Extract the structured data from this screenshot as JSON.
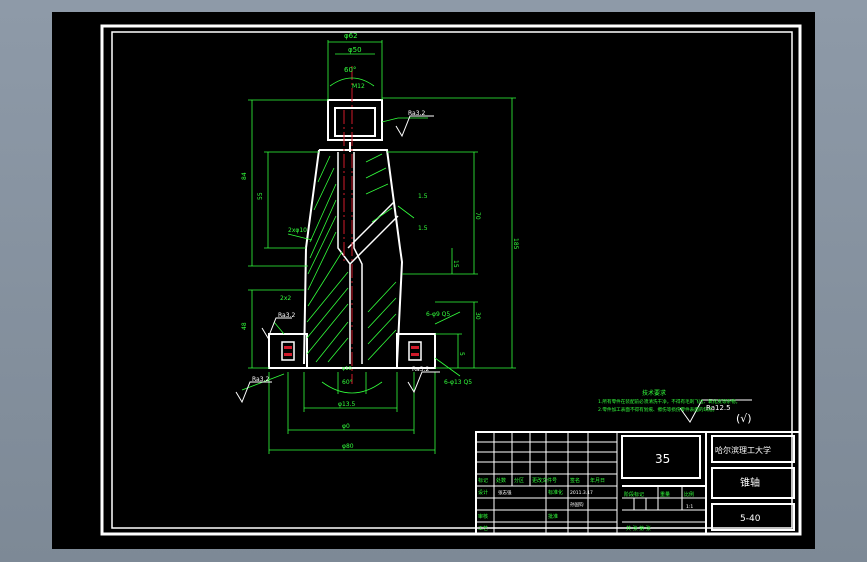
{
  "drawing": {
    "part_name": "锥轴",
    "university": "哈尔滨理工大学",
    "material": "35",
    "drawing_number": "5-40",
    "scale": "1:1"
  },
  "tech_requirements": {
    "title": "技术要求",
    "line1": "1.所有零件在装配前必须清洗干净，不得有毛刺飞边、氧化皮等杂物。",
    "line2": "2.零件加工表面不得有划痕、擦伤等损伤零件表面的缺陷。"
  },
  "surface_finish": {
    "general": "Ra12.5",
    "other": "(√)",
    "top": "Ra3.2",
    "left": "Ra3.2",
    "bottom_left": "Ra3.2",
    "bottom_right": "Ra3.2"
  },
  "dimensions": {
    "top_width": "φ62",
    "top_sub": "φ50",
    "angle_top": "60°",
    "top_thread": "M12",
    "upper_chamfer": "1.5",
    "lower_chamfer": "1.5",
    "left_chamfer": "2xφ10",
    "bottom_chamfer": "2x2",
    "bottom_angle": "60°",
    "hole1": "φ13.5",
    "hole2": "φ0",
    "bore": "φ10",
    "hole_pattern1": "6-φ9 Q5",
    "hole_pattern2": "6-φ13 Q5",
    "outer_dia": "φ80",
    "h_total": "185",
    "h_mid": "70",
    "h_lower": "15",
    "h_base": "5",
    "h_left_top": "84",
    "h_left_mid": "55",
    "h_left_bot": "48",
    "r_right": "30"
  },
  "title_block": {
    "headers": [
      "标记",
      "处数",
      "分区",
      "更改文件号",
      "签名",
      "年月日"
    ],
    "labels": {
      "designer": "设计",
      "checker": "审核",
      "process": "工艺",
      "standardization": "标准化",
      "approval": "批准",
      "stage_mark": "阶段标记",
      "weight": "重量",
      "scale_label": "比例",
      "sheet_info": "共 张 第 张"
    },
    "designer_name": "张志强",
    "checker_name": "孙国钧",
    "date": "2011.3.17"
  }
}
